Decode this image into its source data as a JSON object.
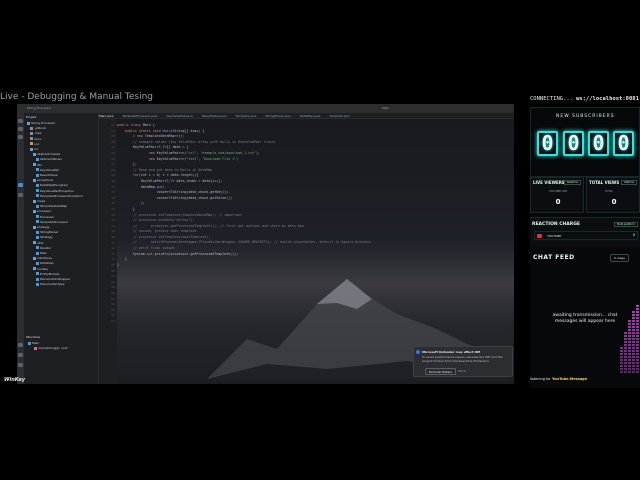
{
  "stream": {
    "title": "Live - Debugging & Manual Tesing",
    "logo": "WinKey"
  },
  "ide": {
    "titlebar_left": "String Processor",
    "titlebar_right": "Main",
    "tabs": [
      {
        "label": "Main.java",
        "active": true
      },
      {
        "label": "TemplateProcessor.java",
        "active": false
      },
      {
        "label": "KeyValuePair.java",
        "active": false
      },
      {
        "label": "ResultValue.java",
        "active": false
      },
      {
        "label": "Template.java",
        "active": false
      },
      {
        "label": "StringParser.java",
        "active": false
      },
      {
        "label": "DataMap.java",
        "active": false
      },
      {
        "label": "template.json",
        "active": false
      }
    ],
    "project_header": "Project",
    "tree": [
      {
        "label": "String Processor",
        "depth": 0,
        "color": "#6a9fd8"
      },
      {
        "label": ".gitbook",
        "depth": 1,
        "color": "#8c8f94"
      },
      {
        "label": ".idea",
        "depth": 1,
        "color": "#8c8f94"
      },
      {
        "label": "docs",
        "depth": 1,
        "color": "#8c8f94"
      },
      {
        "label": "out",
        "depth": 1,
        "color": "#d89a4a"
      },
      {
        "label": "src",
        "depth": 1,
        "color": "#6a9fd8"
      },
      {
        "label": "abstractclasses",
        "depth": 2,
        "color": "#6a9fd8"
      },
      {
        "label": "AbstractParser",
        "depth": 3,
        "color": "#3d9ee0"
      },
      {
        "label": "dto",
        "depth": 2,
        "color": "#6a9fd8"
      },
      {
        "label": "KeyValuePair",
        "depth": 3,
        "color": "#3d9ee0"
      },
      {
        "label": "ResultValue",
        "depth": 3,
        "color": "#3d9ee0"
      },
      {
        "label": "exceptions",
        "depth": 2,
        "color": "#6a9fd8"
      },
      {
        "label": "DataMapException",
        "depth": 3,
        "color": "#3d9ee0"
      },
      {
        "label": "KeyValuePairException",
        "depth": 3,
        "color": "#3d9ee0"
      },
      {
        "label": "TemplateProcessorException",
        "depth": 3,
        "color": "#3d9ee0"
      },
      {
        "label": "maps",
        "depth": 2,
        "color": "#6a9fd8"
      },
      {
        "label": "TemplateDataMap",
        "depth": 3,
        "color": "#3d9ee0"
      },
      {
        "label": "processor",
        "depth": 2,
        "color": "#6a9fd8"
      },
      {
        "label": "Processor",
        "depth": 3,
        "color": "#3d9ee0"
      },
      {
        "label": "TemplateProcessor",
        "depth": 3,
        "color": "#3d9ee0"
      },
      {
        "label": "strategy",
        "depth": 2,
        "color": "#6a9fd8"
      },
      {
        "label": "StringParser",
        "depth": 3,
        "color": "#3d9ee0"
      },
      {
        "label": "Strategy",
        "depth": 3,
        "color": "#3d9ee0"
      },
      {
        "label": "utils",
        "depth": 2,
        "color": "#6a9fd8"
      },
      {
        "label": "Iterator",
        "depth": 3,
        "color": "#3d9ee0"
      },
      {
        "label": "Main",
        "depth": 3,
        "color": "#3d9ee0"
      },
      {
        "label": "interfaces",
        "depth": 2,
        "color": "#6a9fd8"
      },
      {
        "label": "DataMap",
        "depth": 3,
        "color": "#3d9ee0"
      },
      {
        "label": "models",
        "depth": 2,
        "color": "#6a9fd8"
      },
      {
        "label": "EntityModels",
        "depth": 3,
        "color": "#3d9ee0"
      },
      {
        "label": "PlaceholderWrapper",
        "depth": 3,
        "color": "#3d9ee0"
      },
      {
        "label": "PlaceholderType",
        "depth": 3,
        "color": "#3d9ee0"
      }
    ],
    "structure_header": "Structure",
    "structure_items": [
      "Main",
      "main(String[]): void"
    ],
    "code_lines": [
      [
        {
          "t": "public class ",
          "c": "kw"
        },
        {
          "t": "Main {",
          "c": ""
        }
      ],
      [
        {
          "t": "    public static void ",
          "c": "kw"
        },
        {
          "t": "main",
          "c": "fn"
        },
        {
          "t": "(String[] args) {",
          "c": ""
        }
      ],
      [
        {
          "t": "",
          "c": ""
        }
      ],
      [
        {
          "t": "        ",
          "c": ""
        },
        {
          "t": "= new ",
          "c": "kw"
        },
        {
          "t": "TemplateDataMap<>();",
          "c": ""
        }
      ],
      [
        {
          "t": "",
          "c": ""
        }
      ],
      [
        {
          "t": "",
          "c": ""
        }
      ],
      [
        {
          "t": "        // example values (key ValuePair array with Nulls in KeyValuePair class)",
          "c": "cm"
        }
      ],
      [
        {
          "t": "        KeyValuePair<?,?>[] data = {",
          "c": ""
        }
      ],
      [
        {
          "t": "                new ",
          "c": "kw"
        },
        {
          "t": "KeyValuePair<>(",
          "c": ""
        },
        {
          "t": "\"url\"",
          "c": "st"
        },
        {
          "t": ", ",
          "c": ""
        },
        {
          "t": "\"example.com/download_1.txt\"",
          "c": "st"
        },
        {
          "t": "),",
          "c": ""
        }
      ],
      [
        {
          "t": "                new ",
          "c": "kw"
        },
        {
          "t": "KeyValuePair<>(",
          "c": ""
        },
        {
          "t": "\"text\"",
          "c": "st"
        },
        {
          "t": ", ",
          "c": ""
        },
        {
          "t": "\"Download File 1\"",
          "c": "st"
        },
        {
          "t": ")",
          "c": ""
        }
      ],
      [
        {
          "t": "        };",
          "c": ""
        }
      ],
      [
        {
          "t": "",
          "c": ""
        }
      ],
      [
        {
          "t": "        // Read and put data to Nulls in DataMap",
          "c": "cm"
        }
      ],
      [
        {
          "t": "        for",
          "c": "kw"
        },
        {
          "t": "(int i = 0; i < data.length;){",
          "c": ""
        }
      ],
      [
        {
          "t": "            KeyValuePair<?,?> data_chunk = data[i++];",
          "c": ""
        }
      ],
      [
        {
          "t": "",
          "c": ""
        }
      ],
      [
        {
          "t": "            dataMap.",
          "c": ""
        },
        {
          "t": "put",
          "c": "fn"
        },
        {
          "t": "(",
          "c": ""
        }
      ],
      [
        {
          "t": "                    convertToString(data_chunk.getKey()),",
          "c": ""
        }
      ],
      [
        {
          "t": "                    convertToString(data_chunk.getValue())",
          "c": ""
        }
      ],
      [
        {
          "t": "            );",
          "c": ""
        }
      ],
      [
        {
          "t": "        }",
          "c": ""
        }
      ],
      [
        {
          "t": "",
          "c": ""
        }
      ],
      [
        {
          "t": "",
          "c": ""
        }
      ],
      [
        {
          "t": "",
          "c": ""
        }
      ],
      [
        {
          "t": "        // processor.setTemplate(templateDataMap); // important",
          "c": "cm"
        }
      ],
      [
        {
          "t": "        // processor.putData(\"button\");",
          "c": "cm"
        }
      ],
      [
        {
          "t": "        //       processor.getProcessedTemplate()); // first get buttons and store as data map",
          "c": "cm"
        }
      ],
      [
        {
          "t": "",
          "c": ""
        }
      ],
      [
        {
          "t": "        // second, process main template.",
          "c": "cm"
        }
      ],
      [
        {
          "t": "        // processor.setTemplate(mainTemplate);",
          "c": "cm"
        }
      ],
      [
        {
          "t": "        //       switchPlaceholderWrapper(PlaceholderWrapper.SQUARE_BRACKETS); // switch placeholder, default is Square brackets",
          "c": "cm"
        }
      ],
      [
        {
          "t": "",
          "c": ""
        }
      ],
      [
        {
          "t": "        // print final output",
          "c": "cm"
        }
      ],
      [
        {
          "t": "        System.",
          "c": ""
        },
        {
          "t": "out",
          "c": "kw"
        },
        {
          "t": ".println(processor.getProcessedTemplate());",
          "c": ""
        }
      ],
      [
        {
          "t": "    }",
          "c": ""
        }
      ],
      [
        {
          "t": "}",
          "c": ""
        }
      ]
    ],
    "notification": {
      "title": "Microsoft Defender may affect IDE",
      "body": "To avoid performance issues, exclude the IDE and the project folders from the Real-time Protection.",
      "button": "Exclude folders",
      "more": "More"
    }
  },
  "overlay": {
    "connection_status": "CONNECTING...",
    "ws_url": "ws://localhost:8081",
    "subscribers_title": "NEW SUBSCRIBERS",
    "subscriber_digits": [
      "0",
      "0",
      "0",
      "0"
    ],
    "live_viewers": {
      "title": "LIVE VIEWERS",
      "tag": "Realtime",
      "sub": "YOUTUBE LIVE",
      "value": "0"
    },
    "total_views": {
      "title": "TOTAL VIEWS",
      "tag": "Lifetime",
      "sub": "TOTAL",
      "value": "0"
    },
    "reaction": {
      "title": "REACTION CHARGE",
      "tag": "Multi-platform",
      "platform": "YOUTUBE",
      "count": "0"
    },
    "chat": {
      "title": "CHAT FEED",
      "badge": "0 msgs",
      "waiting": "awaiting transmission... chat messages will appear here"
    },
    "listen": {
      "prefix": "listening for",
      "source": "YouTube.Message"
    },
    "accent_color": "#32e6e0",
    "eq_color": "#c43ad6"
  }
}
